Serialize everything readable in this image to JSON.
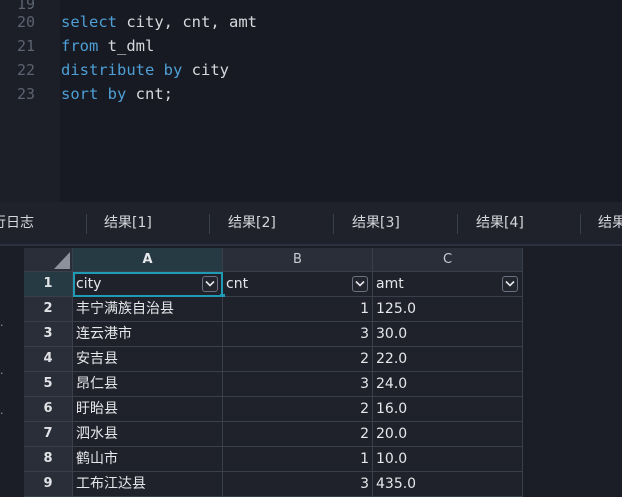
{
  "editor": {
    "lines": [
      {
        "n": "19",
        "kw": "",
        "rest": ""
      },
      {
        "n": "20",
        "kw": "select",
        "rest": " city, cnt, amt"
      },
      {
        "n": "21",
        "kw": "from",
        "rest": " t_dml"
      },
      {
        "n": "22",
        "kw": "distribute by",
        "rest": " city"
      },
      {
        "n": "23",
        "kw": "sort by",
        "rest": " cnt;"
      }
    ]
  },
  "tabs": [
    "行日志",
    "结果[1]",
    "结果[2]",
    "结果[3]",
    "结果[4]",
    "结果"
  ],
  "grid": {
    "columns": [
      "A",
      "B",
      "C"
    ],
    "header_row": {
      "num": "1",
      "cells": [
        "city",
        "cnt",
        "amt"
      ]
    },
    "rows": [
      {
        "num": "2",
        "city": "丰宁满族自治县",
        "cnt": "1",
        "amt": "125.0"
      },
      {
        "num": "3",
        "city": "连云港市",
        "cnt": "3",
        "amt": "30.0"
      },
      {
        "num": "4",
        "city": "安吉县",
        "cnt": "2",
        "amt": "22.0"
      },
      {
        "num": "5",
        "city": "昂仁县",
        "cnt": "3",
        "amt": "24.0"
      },
      {
        "num": "6",
        "city": "盱眙县",
        "cnt": "2",
        "amt": "16.0"
      },
      {
        "num": "7",
        "city": "泗水县",
        "cnt": "2",
        "amt": "20.0"
      },
      {
        "num": "8",
        "city": "鹤山市",
        "cnt": "1",
        "amt": "10.0"
      },
      {
        "num": "9",
        "city": "工布江达县",
        "cnt": "3",
        "amt": "435.0"
      }
    ]
  },
  "colors": {
    "accent": "#1f9bb5",
    "keyword": "#4e9fd6"
  }
}
